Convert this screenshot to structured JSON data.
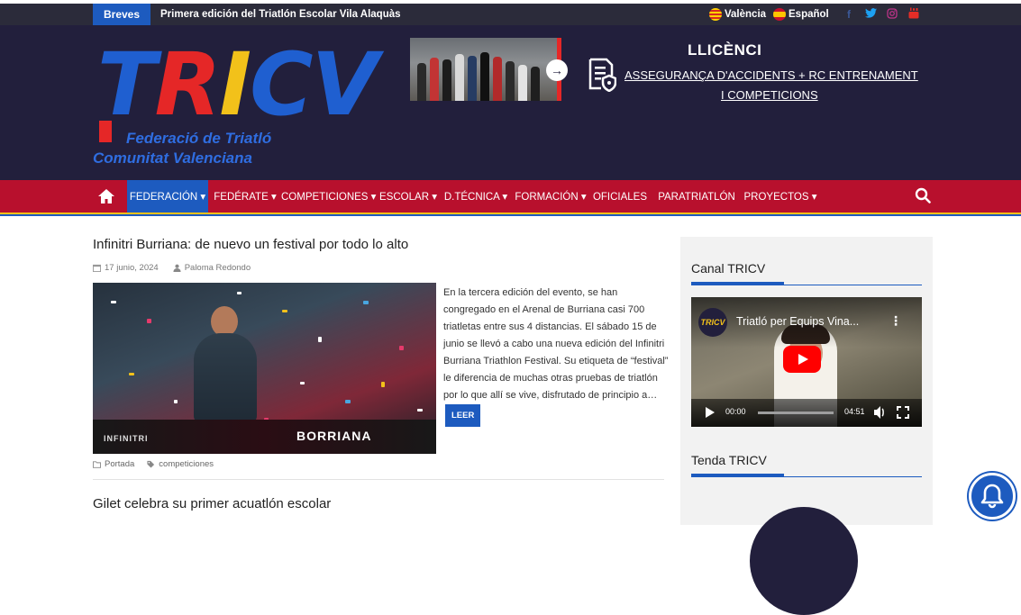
{
  "topbar": {
    "breves_label": "Breves",
    "ticker_text": "Primera edición del Triatlón Escolar Vila Alaquàs",
    "lang_valencia": "València",
    "lang_espanol": "Español",
    "social_icons": [
      "facebook-icon",
      "twitter-icon",
      "instagram-icon",
      "youtube-icon"
    ]
  },
  "header": {
    "logo_letters": [
      "T",
      "R",
      "I",
      "CV"
    ],
    "logo_sub1": "Federació de Triatló",
    "logo_sub2": "Comunitat Valenciana",
    "banner": {
      "title": "LLICÈNCI",
      "line1": "ASSEGURANÇA D'ACCIDENTS + RC ENTRENAMENT",
      "line2": "I COMPETICIONS"
    }
  },
  "nav": {
    "items": [
      {
        "label": "FEDERACIÓN ▾",
        "active": true
      },
      {
        "label": "FEDÉRATE ▾"
      },
      {
        "label": "COMPETICIONES ▾"
      },
      {
        "label": "ESCOLAR ▾"
      },
      {
        "label": "D.TÉCNICA ▾"
      },
      {
        "label": "FORMACIÓN ▾"
      },
      {
        "label": "OFICIALES"
      },
      {
        "label": "PARATRIATLÓN"
      },
      {
        "label": "PROYECTOS ▾"
      }
    ]
  },
  "posts": [
    {
      "title": "Infinitri Burriana: de nuevo un festival por todo lo alto",
      "date": "17 junio, 2024",
      "author": "Paloma Redondo",
      "excerpt": "En la tercera edición del evento, se han congregado en el Arenal de Burriana casi 700 triatletas entre sus 4 distancias. El sábado 15 de junio se llevó a cabo una nueva edición del Infinitri Burriana Triathlon Festival. Su etiqueta de “festival” le diferencia de muchas otras pruebas de triatlón por lo que allí se vive, disfrutado de principio a…",
      "read_more": "LEER",
      "category": "Portada",
      "tag": "competiciones",
      "image_text_finish": "BORRIANA",
      "image_text_brand": "INFINITRI"
    },
    {
      "title": "Gilet celebra su primer acuatlón escolar"
    }
  ],
  "sidebar": {
    "canal_title": "Canal TRICV",
    "video": {
      "channel_logo": "TRICV",
      "title": "Triatló per Equips Vina...",
      "current_time": "00:00",
      "duration": "04:51"
    },
    "tenda_title": "Tenda TRICV"
  },
  "colors": {
    "navy": "#221f3c",
    "nav_red": "#b8102d",
    "blue": "#1d5bbf",
    "yellow": "#f2c11a"
  }
}
